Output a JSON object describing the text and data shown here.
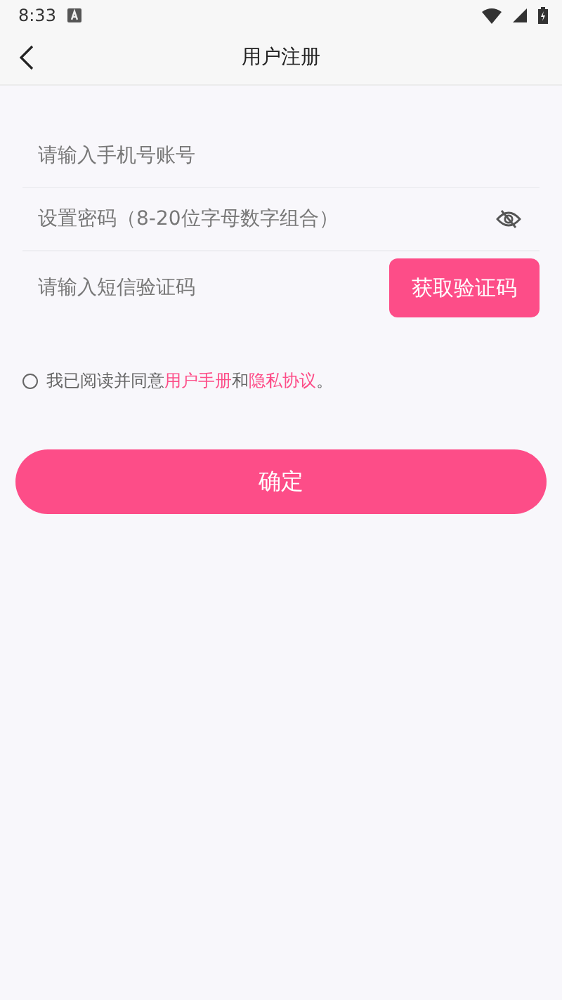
{
  "status_bar": {
    "time": "8:33"
  },
  "header": {
    "title": "用户注册"
  },
  "fields": [
    {
      "kind": "text",
      "placeholder": "请输入手机号账号"
    },
    {
      "kind": "password",
      "placeholder": "设置密码（8-20位字母数字组合）"
    },
    {
      "kind": "code",
      "placeholder": "请输入短信验证码",
      "button": "获取验证码"
    }
  ],
  "agreement": {
    "checked": false,
    "parts": [
      {
        "kind": "text",
        "text": "我已阅读并同意"
      },
      {
        "kind": "link",
        "text": "用户手册"
      },
      {
        "kind": "text",
        "text": "和"
      },
      {
        "kind": "link",
        "text": "隐私协议"
      },
      {
        "kind": "text",
        "text": "。"
      }
    ]
  },
  "submit": "确定"
}
